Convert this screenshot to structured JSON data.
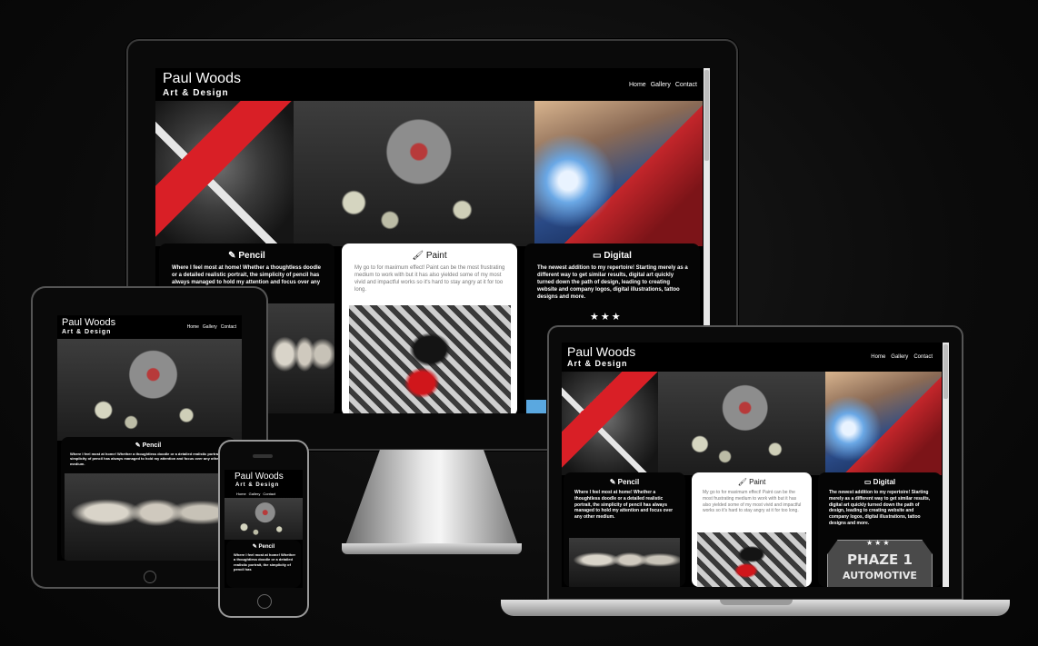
{
  "site": {
    "brand_name": "Paul Woods",
    "brand_sub": "Art & Design",
    "nav": [
      "Home",
      "Gallery",
      "Contact"
    ]
  },
  "cards": {
    "pencil": {
      "icon": "pencil-icon",
      "title": "Pencil",
      "text": "Where I feel most at home! Whether a thoughtless doodle or a detailed realistic portrait, the simplicity of pencil has always managed to hold my attention and focus over any other medium.",
      "text_imac": "Where I feel most at home! Whether a thoughtless doodle or a detailed realistic portrait, the simplicity of pencil has always managed to hold my attention and focus over any"
    },
    "paint": {
      "icon": "paint-brush-icon",
      "title": "Paint",
      "text": "My go to for maximum effect! Paint can be the most frustrating medium to work with but it has also yielded some of my most vivid and impactful works so it's hard to stay angry at it for too long."
    },
    "digital": {
      "icon": "monitor-icon",
      "title": "Digital",
      "text": "The newest addition to my repertoire! Starting merely as a different way to get similar results, digital art quickly turned down the path of design, leading to creating website and company logos, digital illustrations, tattoo designs and more."
    }
  },
  "badge": {
    "stars": "★★★",
    "line1": "PHAZE 1",
    "line2": "AUTOMOTIVE"
  },
  "tablet": {
    "pencil_text": "Where I feel most at home! Whether a thoughtless doodle or a detailed realistic portrait, the simplicity of pencil has always managed to hold my attention and focus over any other medium."
  },
  "phone": {
    "pencil_text": "Where I feel most at home! Whether a thoughtless doodle or a detailed realistic portrait, the simplicity of pencil has"
  },
  "colors": {
    "background": "#0b0b0b",
    "accent_red": "#d91f26",
    "card_dark": "#050505",
    "card_light": "#ffffff",
    "accent_blue": "#5aa8e0"
  }
}
